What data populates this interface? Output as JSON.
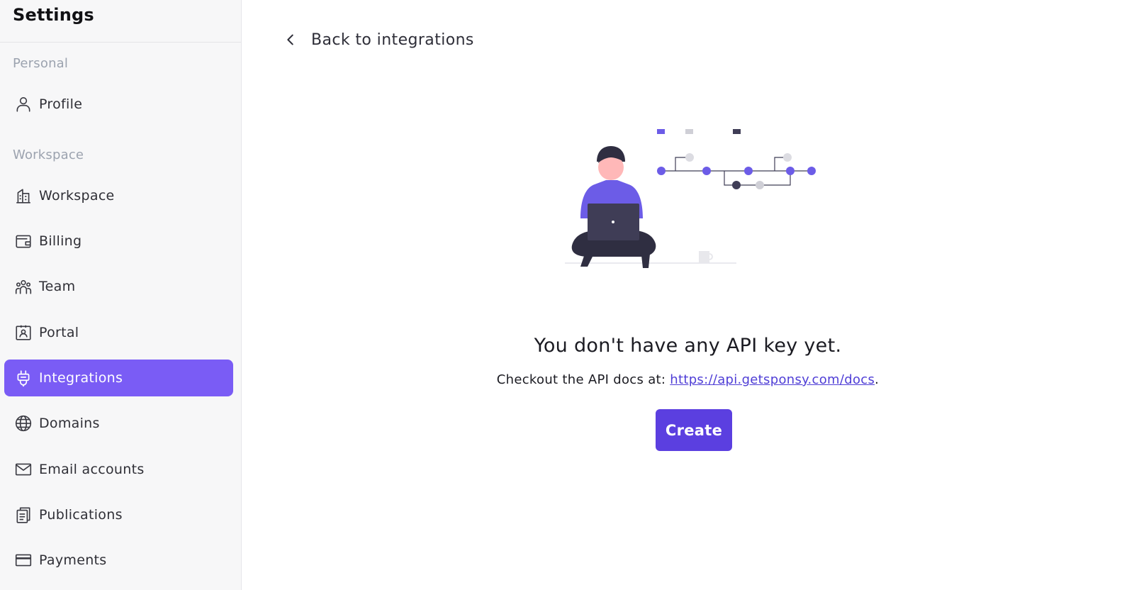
{
  "sidebar": {
    "title": "Settings",
    "sections": {
      "personal": "Personal",
      "workspace": "Workspace"
    },
    "items": [
      {
        "label": "Profile",
        "icon": "user-icon"
      },
      {
        "label": "Workspace",
        "icon": "building-icon"
      },
      {
        "label": "Billing",
        "icon": "wallet-icon"
      },
      {
        "label": "Team",
        "icon": "team-icon"
      },
      {
        "label": "Portal",
        "icon": "portal-icon"
      },
      {
        "label": "Integrations",
        "icon": "plug-icon",
        "active": true
      },
      {
        "label": "Domains",
        "icon": "globe-icon"
      },
      {
        "label": "Email accounts",
        "icon": "mail-icon"
      },
      {
        "label": "Publications",
        "icon": "documents-icon"
      },
      {
        "label": "Payments",
        "icon": "credit-card-icon"
      }
    ]
  },
  "main": {
    "back_label": "Back to integrations",
    "empty_title": "You don't have any API key yet.",
    "docs_prefix": "Checkout the API docs at: ",
    "docs_link": "https://api.getsponsy.com/docs",
    "docs_suffix": ".",
    "create_label": "Create"
  },
  "colors": {
    "accent": "#7a5cf5",
    "button": "#5b3fe0",
    "link": "#4f3ed6",
    "sidebar_bg": "#f7f7f8"
  }
}
